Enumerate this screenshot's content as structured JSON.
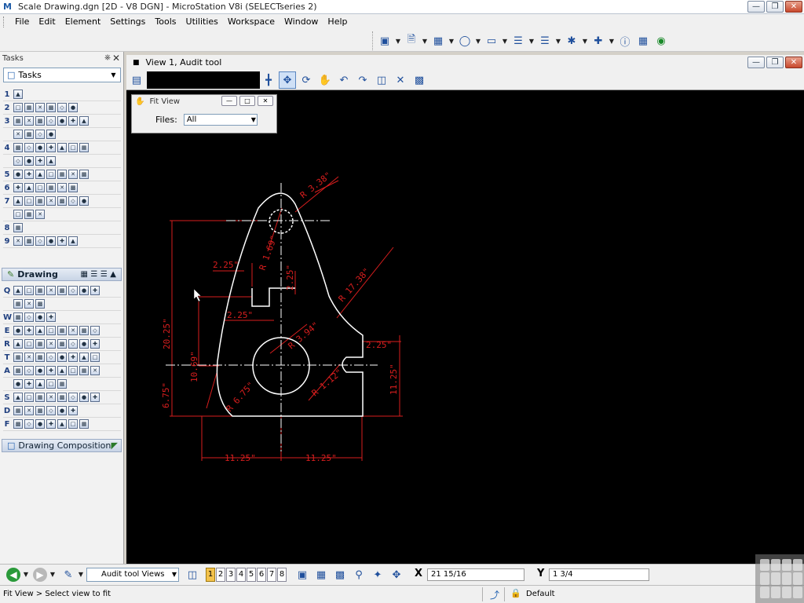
{
  "window": {
    "title": "Scale Drawing.dgn [2D - V8 DGN] - MicroStation V8i (SELECTseries 2)"
  },
  "menu": {
    "items": [
      "File",
      "Edit",
      "Element",
      "Settings",
      "Tools",
      "Utilities",
      "Workspace",
      "Window",
      "Help"
    ]
  },
  "tasks_panel": {
    "header": "Tasks",
    "combo_value": "Tasks",
    "row_numbers": [
      "1",
      "2",
      "3",
      "",
      "4",
      "",
      "5",
      "6",
      "7",
      "",
      "8",
      "9"
    ],
    "drawing_header": "Drawing",
    "drawing_row_letters": [
      "Q",
      "",
      "W",
      "E",
      "R",
      "T",
      "A",
      "",
      "S",
      "D",
      "F"
    ],
    "composition_header": "Drawing Composition"
  },
  "view_window": {
    "title": "View 1, Audit tool"
  },
  "fit_view_dialog": {
    "title": "Fit View",
    "files_label": "Files:",
    "files_value": "All"
  },
  "drawing": {
    "dimensions": {
      "d_top_radius": "R 3.38\"",
      "d_inner_radius": "R 1.69\"",
      "d_slot_width": "2.25\"",
      "d_slot_small": "2.25\"",
      "d_slot_height": "2.25\"",
      "d_overall_height": "20.25\"",
      "d_mid_height": "10.69\"",
      "d_arc_radius": "R 17.38\"",
      "d_hole_radius": "R 3.94\"",
      "d_right_offset": "2.25\"",
      "d_bottom_radius": "R 1.12\"",
      "d_right_height": "11.25\"",
      "d_left_small": "6.75\"",
      "d_bottom_arc": "R 6.75\"",
      "d_bottom_left": "11.25\"",
      "d_bottom_right": "11.25\""
    }
  },
  "bottom_toolbar": {
    "views_combo": "Audit tool Views",
    "view_numbers": [
      "1",
      "2",
      "3",
      "4",
      "5",
      "6",
      "7",
      "8"
    ],
    "active_view": "1",
    "x_label": "X",
    "x_value": "21 15/16",
    "y_label": "Y",
    "y_value": "1 3/4"
  },
  "status": {
    "message": "Fit View > Select view to fit",
    "level": "Default"
  },
  "colors": {
    "geometry": "#ffffff",
    "dimensions": "#d81e1e",
    "canvas": "#000000"
  }
}
